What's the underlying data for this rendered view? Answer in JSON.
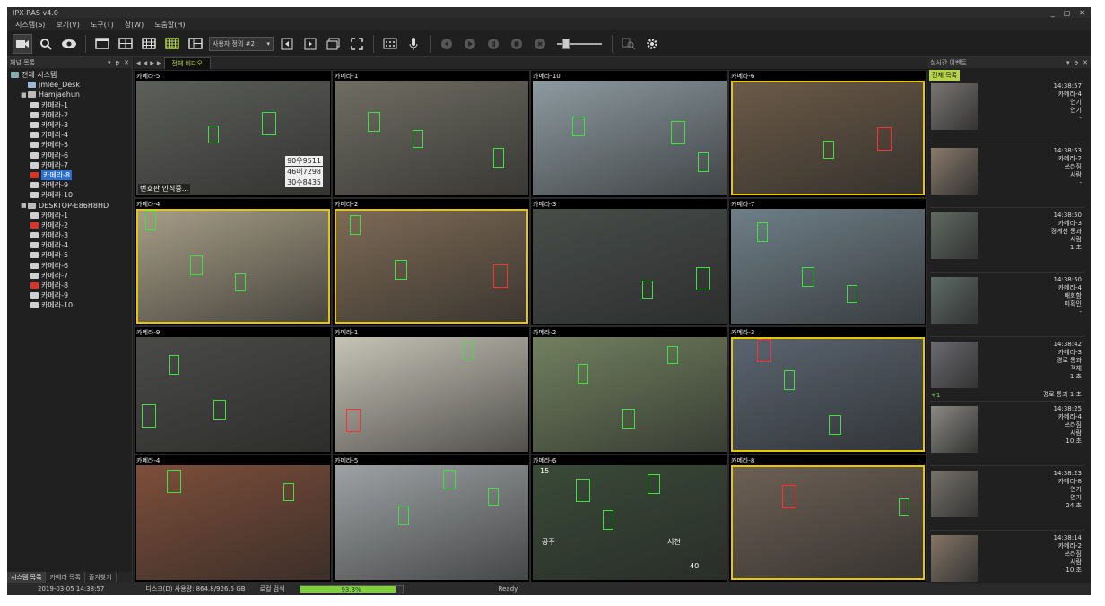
{
  "window": {
    "title": "IPX-RAS v4.0",
    "controls": [
      "_",
      "▢",
      "✕"
    ]
  },
  "menu": [
    "시스템(S)",
    "보기(V)",
    "도구(T)",
    "창(W)",
    "도움말(H)"
  ],
  "toolbar": {
    "preset_label": "사용자 정의 #2"
  },
  "left_panel": {
    "title": "채널 목록",
    "tree": [
      {
        "label": "전체 시스템",
        "level": 0,
        "icon": "sys"
      },
      {
        "label": "jmlee_Desk",
        "level": 1,
        "icon": "cube"
      },
      {
        "label": "Hamjaehun",
        "level": 1,
        "icon": "pc",
        "expand": "■"
      },
      {
        "label": "카메라-1",
        "level": 2,
        "icon": "cam"
      },
      {
        "label": "카메라-2",
        "level": 2,
        "icon": "cam"
      },
      {
        "label": "카메라-3",
        "level": 2,
        "icon": "cam"
      },
      {
        "label": "카메라-4",
        "level": 2,
        "icon": "cam"
      },
      {
        "label": "카메라-5",
        "level": 2,
        "icon": "cam"
      },
      {
        "label": "카메라-6",
        "level": 2,
        "icon": "cam"
      },
      {
        "label": "카메라-7",
        "level": 2,
        "icon": "cam"
      },
      {
        "label": "카메라-8",
        "level": 2,
        "icon": "red",
        "selected": true
      },
      {
        "label": "카메라-9",
        "level": 2,
        "icon": "cam"
      },
      {
        "label": "카메라-10",
        "level": 2,
        "icon": "cam"
      },
      {
        "label": "DESKTOP-E86H8HD",
        "level": 1,
        "icon": "pc",
        "expand": "■"
      },
      {
        "label": "카메라-1",
        "level": 2,
        "icon": "cam"
      },
      {
        "label": "카메라-2",
        "level": 2,
        "icon": "red"
      },
      {
        "label": "카메라-3",
        "level": 2,
        "icon": "cam"
      },
      {
        "label": "카메라-4",
        "level": 2,
        "icon": "cam"
      },
      {
        "label": "카메라-5",
        "level": 2,
        "icon": "cam"
      },
      {
        "label": "카메라-6",
        "level": 2,
        "icon": "cam"
      },
      {
        "label": "카메라-7",
        "level": 2,
        "icon": "cam"
      },
      {
        "label": "카메라-8",
        "level": 2,
        "icon": "red"
      },
      {
        "label": "카메라-9",
        "level": 2,
        "icon": "cam"
      },
      {
        "label": "카메라-10",
        "level": 2,
        "icon": "cam"
      }
    ],
    "bottom_tabs": [
      "시스템 목록",
      "카메라 목록",
      "즐겨찾기"
    ]
  },
  "center": {
    "tab_label": "전체 비디오",
    "cells": [
      {
        "name": "카메라-5",
        "bg": "#5d5f5a",
        "overlay": [
          "90우9511",
          "46머7298",
          "30수8435"
        ],
        "caption": "번호판 인식중..."
      },
      {
        "name": "카메라-1",
        "bg": "#6f6d62"
      },
      {
        "name": "카메라-10",
        "bg": "#8d9aa0"
      },
      {
        "name": "카메라-6",
        "bg": "#6b5a48",
        "selected": true
      },
      {
        "name": "카메라-4",
        "bg": "#a69d86",
        "selected": true
      },
      {
        "name": "카메라-2",
        "bg": "#7d6a55",
        "selected": true
      },
      {
        "name": "카메라-3",
        "bg": "#484d4a"
      },
      {
        "name": "카메라-7",
        "bg": "#6f7f88"
      },
      {
        "name": "카메라-9",
        "bg": "#4a4a48"
      },
      {
        "name": "카메라-1",
        "bg": "#c6c3b6"
      },
      {
        "name": "카메라-2",
        "bg": "#71805f"
      },
      {
        "name": "카메라-3",
        "bg": "#5a6470",
        "selected": true
      },
      {
        "name": "카메라-4",
        "bg": "#7d4e3a"
      },
      {
        "name": "카메라-5",
        "bg": "#9ea2a4"
      },
      {
        "name": "카메라-6",
        "bg": "#3a4a38",
        "overlay": [
          "15",
          "공주",
          "서천",
          "40"
        ]
      },
      {
        "name": "카메라-8",
        "bg": "#6d6055",
        "selected": true
      }
    ]
  },
  "right_panel": {
    "title": "실시간 이벤트",
    "tab": "전체 목록",
    "events": [
      {
        "time": "14:38:57",
        "cam": "카메라-4",
        "type": "연기",
        "detail": "연기",
        "extra": "-",
        "bg": "#7a7672"
      },
      {
        "time": "14:38:53",
        "cam": "카메라-2",
        "type": "쓰러짐",
        "detail": "사람",
        "extra": "-",
        "bg": "#8a7a6a"
      },
      {
        "time": "14:38:50",
        "cam": "카메라-3",
        "type": "경계선 통과",
        "detail": "사람",
        "extra": "1 초",
        "bg": "#5f6a62"
      },
      {
        "time": "14:38:50",
        "cam": "카메라-4",
        "type": "배회함",
        "detail": "미확인",
        "extra": "-",
        "bg": "#5d6b66"
      },
      {
        "time": "14:38:42",
        "cam": "카메라-3",
        "type": "경로 통과",
        "detail": "객체",
        "extra": "1 초",
        "bottom_l": "+1",
        "bottom_r": "경로 통과   1 초",
        "bg": "#6a6a70"
      },
      {
        "time": "14:38:25",
        "cam": "카메라-4",
        "type": "쓰러짐",
        "detail": "사람",
        "extra": "10 초",
        "bg": "#8a8984"
      },
      {
        "time": "14:38:23",
        "cam": "카메라-8",
        "type": "연기",
        "detail": "연기",
        "extra": "24 초",
        "bg": "#77736c"
      },
      {
        "time": "14:38:14",
        "cam": "카메라-2",
        "type": "쓰러짐",
        "detail": "사람",
        "extra": "10 초",
        "bg": "#857565"
      }
    ]
  },
  "status": {
    "datetime": "2019-03-05 14:38:57",
    "disk": "디스크(D) 사용량: 864.8/926.5 GB",
    "search": "로컬 검색",
    "progress_label": "93.3%",
    "progress": 0.933,
    "state": "Ready"
  }
}
